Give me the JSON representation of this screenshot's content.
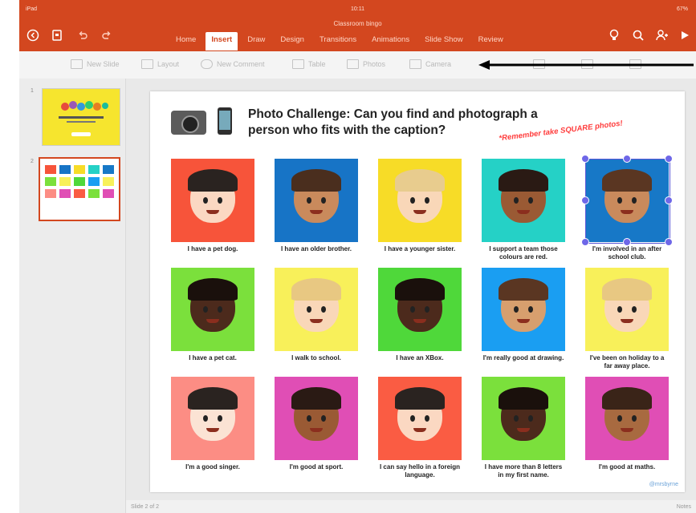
{
  "status": {
    "device": "iPad",
    "time": "10:11",
    "battery": "67%"
  },
  "document_title": "Classroom bingo",
  "tabs": [
    {
      "label": "Home"
    },
    {
      "label": "Insert",
      "active": true
    },
    {
      "label": "Draw"
    },
    {
      "label": "Design"
    },
    {
      "label": "Transitions"
    },
    {
      "label": "Animations"
    },
    {
      "label": "Slide Show"
    },
    {
      "label": "Review"
    }
  ],
  "toolbar": {
    "new_slide": "New Slide",
    "layout": "Layout",
    "new_comment": "New Comment",
    "table": "Table",
    "photos": "Photos",
    "camera": "Camera"
  },
  "thumbnails": [
    {
      "number": "1"
    },
    {
      "number": "2",
      "selected": true
    }
  ],
  "slide": {
    "title": "Photo Challenge: Can you find and photograph a person who fits with the caption?",
    "reminder": "*Remember take SQUARE photos!",
    "credit": "@mrsbyrne",
    "cards": [
      {
        "caption": "I have a pet dog.",
        "bg": "#f7543a",
        "skin": "#fbd8c2",
        "hair": "#2a2320"
      },
      {
        "caption": "I have an older brother.",
        "bg": "#1774c6",
        "skin": "#c98a5c",
        "hair": "#4a2e1e"
      },
      {
        "caption": "I have a younger sister.",
        "bg": "#f7dc27",
        "skin": "#f9d7b8",
        "hair": "#e8cc8e"
      },
      {
        "caption": "I support a team those colours are red.",
        "bg": "#25d1c6",
        "skin": "#9a5a34",
        "hair": "#2a1a14"
      },
      {
        "caption": "I'm involved in an after school club.",
        "bg": "#1778c7",
        "skin": "#c98a5c",
        "hair": "#5a3622"
      },
      {
        "caption": "I have a pet cat.",
        "bg": "#7be03c",
        "skin": "#4c2a1c",
        "hair": "#1a100c"
      },
      {
        "caption": "I walk to school.",
        "bg": "#f8f05a",
        "skin": "#f9d7b8",
        "hair": "#e8c882"
      },
      {
        "caption": "I have an XBox.",
        "bg": "#4fd83a",
        "skin": "#4c2a1c",
        "hair": "#1a100c"
      },
      {
        "caption": "I'm really good at drawing.",
        "bg": "#1a9ef2",
        "skin": "#d79f6e",
        "hair": "#5a3622"
      },
      {
        "caption": "I've been on holiday to a far away place.",
        "bg": "#f8f05a",
        "skin": "#f9d7b8",
        "hair": "#e8c882"
      },
      {
        "caption": "I'm a good singer.",
        "bg": "#fc8d84",
        "skin": "#fbe3d4",
        "hair": "#2a2320"
      },
      {
        "caption": "I'm good at sport.",
        "bg": "#e04eb5",
        "skin": "#9a5a34",
        "hair": "#2a1a14"
      },
      {
        "caption": "I can say hello in a foreign language.",
        "bg": "#fa5c43",
        "skin": "#fbd8c2",
        "hair": "#2a2320"
      },
      {
        "caption": "I have more than 8 letters in my first name.",
        "bg": "#7be03c",
        "skin": "#4c2a1c",
        "hair": "#1a100c"
      },
      {
        "caption": "I'm good at maths.",
        "bg": "#e04eb5",
        "skin": "#a86a40",
        "hair": "#3a2418"
      }
    ]
  },
  "footer": {
    "slide_counter": "Slide 2 of 2",
    "notes": "Notes"
  },
  "colors": {
    "accent": "#d3471f",
    "selection": "#6e67e8"
  }
}
